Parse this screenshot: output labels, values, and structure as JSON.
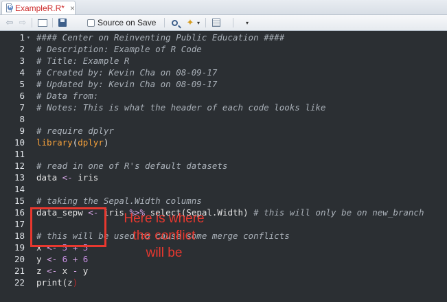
{
  "tab": {
    "title": "ExampleR.R*",
    "file_badge": "R",
    "close_glyph": "×"
  },
  "toolbar": {
    "back_glyph": "⇦",
    "forward_glyph": "⇨",
    "source_on_save_label": "Source on Save",
    "source_on_save_checked": false,
    "wand_glyph": "✦",
    "dropdown_glyph": "▾"
  },
  "editor": {
    "fold_glyph": "▾",
    "lines": [
      {
        "n": "1",
        "tokens": [
          {
            "t": "#### Center on Reinventing Public Education ####",
            "c": "comment"
          }
        ]
      },
      {
        "n": "2",
        "tokens": [
          {
            "t": "# Description: Example of R Code",
            "c": "comment"
          }
        ]
      },
      {
        "n": "3",
        "tokens": [
          {
            "t": "# Title: Example R",
            "c": "comment"
          }
        ]
      },
      {
        "n": "4",
        "tokens": [
          {
            "t": "# Created by: Kevin Cha on 08-09-17",
            "c": "comment"
          }
        ]
      },
      {
        "n": "5",
        "tokens": [
          {
            "t": "# Updated by: Kevin Cha on 08-09-17",
            "c": "comment"
          }
        ]
      },
      {
        "n": "6",
        "tokens": [
          {
            "t": "# Data from:",
            "c": "comment"
          }
        ]
      },
      {
        "n": "7",
        "tokens": [
          {
            "t": "# Notes: This is what the header of each code looks like",
            "c": "comment"
          }
        ]
      },
      {
        "n": "8",
        "tokens": []
      },
      {
        "n": "9",
        "tokens": [
          {
            "t": "# require dplyr",
            "c": "comment"
          }
        ]
      },
      {
        "n": "10",
        "tokens": [
          {
            "t": "library",
            "c": "fn"
          },
          {
            "t": "(",
            "c": "paren"
          },
          {
            "t": "dplyr",
            "c": "fn"
          },
          {
            "t": ")",
            "c": "paren"
          }
        ]
      },
      {
        "n": "11",
        "tokens": []
      },
      {
        "n": "12",
        "tokens": [
          {
            "t": "# read in one of R's default datasets",
            "c": "comment"
          }
        ]
      },
      {
        "n": "13",
        "tokens": [
          {
            "t": "data ",
            "c": ""
          },
          {
            "t": "<-",
            "c": "op"
          },
          {
            "t": " iris",
            "c": ""
          }
        ]
      },
      {
        "n": "14",
        "tokens": []
      },
      {
        "n": "15",
        "tokens": [
          {
            "t": "# taking the Sepal.Width columns",
            "c": "comment"
          }
        ]
      },
      {
        "n": "16",
        "tokens": [
          {
            "t": "data_sepw ",
            "c": ""
          },
          {
            "t": "<-",
            "c": "op"
          },
          {
            "t": " iris ",
            "c": ""
          },
          {
            "t": "%>%",
            "c": "op"
          },
          {
            "t": " select",
            "c": ""
          },
          {
            "t": "(",
            "c": "paren"
          },
          {
            "t": "Sepal.Width",
            "c": ""
          },
          {
            "t": ")",
            "c": "paren"
          },
          {
            "t": " # this will only be on new_branch",
            "c": "comment"
          }
        ]
      },
      {
        "n": "17",
        "tokens": []
      },
      {
        "n": "18",
        "tokens": [
          {
            "t": "# this will be used to cause some merge conflicts",
            "c": "comment"
          }
        ]
      },
      {
        "n": "19",
        "tokens": [
          {
            "t": "x ",
            "c": ""
          },
          {
            "t": "<-",
            "c": "op"
          },
          {
            "t": " ",
            "c": ""
          },
          {
            "t": "5",
            "c": "num"
          },
          {
            "t": " + ",
            "c": "op"
          },
          {
            "t": "5",
            "c": "num"
          }
        ]
      },
      {
        "n": "20",
        "tokens": [
          {
            "t": "y ",
            "c": ""
          },
          {
            "t": "<-",
            "c": "op"
          },
          {
            "t": " ",
            "c": ""
          },
          {
            "t": "6",
            "c": "num"
          },
          {
            "t": " + ",
            "c": "op"
          },
          {
            "t": "6",
            "c": "num"
          }
        ]
      },
      {
        "n": "21",
        "tokens": [
          {
            "t": "z ",
            "c": ""
          },
          {
            "t": "<-",
            "c": "op"
          },
          {
            "t": " x ",
            "c": ""
          },
          {
            "t": "-",
            "c": "op"
          },
          {
            "t": " y",
            "c": ""
          }
        ]
      },
      {
        "n": "22",
        "tokens": [
          {
            "t": "print",
            "c": ""
          },
          {
            "t": "(",
            "c": "paren"
          },
          {
            "t": "z",
            "c": ""
          },
          {
            "t": ")",
            "c": "bad"
          }
        ]
      }
    ]
  },
  "annotation": {
    "text_line1": "Here is where",
    "text_line2": "the conflict",
    "text_line3": "will be",
    "color": "#e8382f"
  }
}
